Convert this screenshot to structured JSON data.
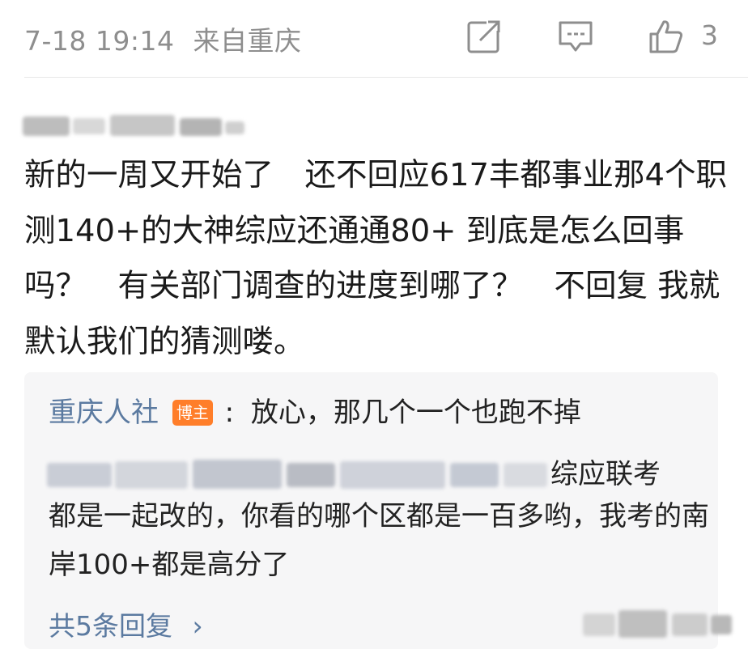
{
  "meta": {
    "timestamp": "7-18 19:14",
    "location": "来自重庆",
    "like_count": "3"
  },
  "comment": {
    "text": "新的一周又开始了　还不回应617丰都事业那4个职测140+的大神综应还通通80+ 到底是怎么回事吗？　有关部门调查的进度到哪了？　不回复 我就默认我们的猜测喽。"
  },
  "reply": {
    "author": "重庆人社",
    "badge": "博主",
    "separator": ":",
    "first_line": "放心，那几个一个也跑不掉",
    "line2_tail": "综应联考",
    "continuation": "都是一起改的，你看的哪个区都是一百多哟，我考的南岸100+都是高分了",
    "more_replies": "共5条回复",
    "more_chevron": "›"
  },
  "icons": {
    "share": "share-icon",
    "comment": "comment-icon",
    "like": "thumbs-up-icon"
  },
  "colors": {
    "meta_gray": "#8e8e8e",
    "link_blue": "#5b7aa0",
    "badge_orange": "#ff7e2a",
    "reply_bg": "#f6f6f7"
  }
}
